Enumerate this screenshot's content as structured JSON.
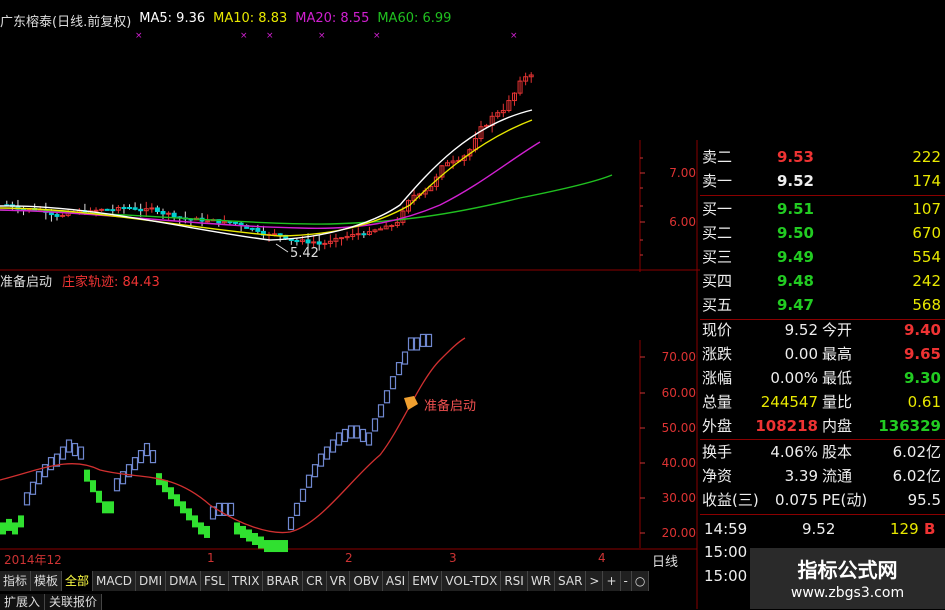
{
  "main_legend": {
    "stock": "广东榕泰(日线.前复权)",
    "ma5": "MA5: 9.36",
    "ma10": "MA10: 8.83",
    "ma20": "MA20: 8.55",
    "ma60": "MA60: 6.99"
  },
  "indicator_legend": {
    "name": "准备启动",
    "value": "庄家轨迹: 84.43"
  },
  "annotations": {
    "low_price": "5.42",
    "signal_label": "准备启动"
  },
  "price_scale": [
    "7.00",
    "6.00"
  ],
  "indicator_scale": [
    "70.00",
    "60.00",
    "50.00",
    "40.00",
    "30.00",
    "20.00"
  ],
  "date_axis": [
    "2014年12",
    "1",
    "2",
    "3",
    "4"
  ],
  "period_label": "日线",
  "quote": {
    "asks": [
      {
        "label": "卖二",
        "price": "9.53",
        "vol": "222"
      },
      {
        "label": "卖一",
        "price": "9.52",
        "vol": "174"
      }
    ],
    "bids": [
      {
        "label": "买一",
        "price": "9.51",
        "vol": "107"
      },
      {
        "label": "买二",
        "price": "9.50",
        "vol": "670"
      },
      {
        "label": "买三",
        "price": "9.49",
        "vol": "554"
      },
      {
        "label": "买四",
        "price": "9.48",
        "vol": "242"
      },
      {
        "label": "买五",
        "price": "9.47",
        "vol": "568"
      }
    ],
    "stats": [
      {
        "l1": "现价",
        "v1": "9.52",
        "l2": "今开",
        "v2": "9.40"
      },
      {
        "l1": "涨跌",
        "v1": "0.00",
        "l2": "最高",
        "v2": "9.65"
      },
      {
        "l1": "涨幅",
        "v1": "0.00%",
        "l2": "最低",
        "v2": "9.30"
      },
      {
        "l1": "总量",
        "v1": "244547",
        "l2": "量比",
        "v2": "0.61"
      },
      {
        "l1": "外盘",
        "v1": "108218",
        "l2": "内盘",
        "v2": "136329"
      },
      {
        "l1": "换手",
        "v1": "4.06%",
        "l2": "股本",
        "v2": "6.02亿"
      },
      {
        "l1": "净资",
        "v1": "3.39",
        "l2": "流通",
        "v2": "6.02亿"
      },
      {
        "l1": "收益(三)",
        "v1": "0.075",
        "l2": "PE(动)",
        "v2": "95.5"
      }
    ],
    "tick": {
      "time": "14:59",
      "price": "9.52",
      "vol": "129",
      "flag": "B"
    },
    "times": [
      "15:00",
      "15:00"
    ]
  },
  "tabs": [
    "指标",
    "模板",
    "全部",
    "MACD",
    "DMI",
    "DMA",
    "FSL",
    "TRIX",
    "BRAR",
    "CR",
    "VR",
    "OBV",
    "ASI",
    "EMV",
    "VOL-TDX",
    "RSI",
    "WR",
    "SAR",
    ">",
    "+",
    "-",
    "○"
  ],
  "tabs2": [
    "扩展入",
    "关联报价"
  ],
  "watermark": {
    "line1": "指标公式网",
    "line2": "www.zbgs3.com"
  },
  "colors": {
    "up": "#e33333",
    "down": "#00d0d0",
    "ma5": "#ffffff",
    "ma10": "#e8e800",
    "ma20": "#d020d0",
    "ma60": "#20c020",
    "grid": "#8a0000"
  },
  "chart_data": {
    "type": "candlestick",
    "title": "广东榕泰(日线.前复权)",
    "series": [
      {
        "name": "MA5",
        "value": 9.36
      },
      {
        "name": "MA10",
        "value": 8.83
      },
      {
        "name": "MA20",
        "value": 8.55
      },
      {
        "name": "MA60",
        "value": 6.99
      }
    ],
    "price_ticks": [
      7.0,
      6.0
    ],
    "low_marker": 5.42,
    "indicator": {
      "name": "庄家轨迹",
      "last": 84.43,
      "ticks": [
        70,
        60,
        50,
        40,
        30,
        20
      ]
    }
  }
}
